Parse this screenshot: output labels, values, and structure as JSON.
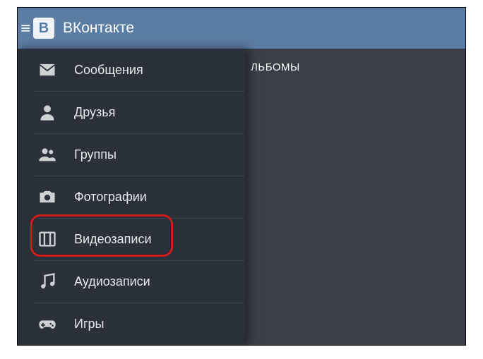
{
  "header": {
    "logo_letter": "В",
    "app_title": "ВКонтакте"
  },
  "content": {
    "visible_tab_fragment": "ЛЬБОМЫ"
  },
  "sidebar": {
    "items": [
      {
        "icon": "envelope-icon",
        "label": "Сообщения"
      },
      {
        "icon": "user-icon",
        "label": "Друзья"
      },
      {
        "icon": "group-icon",
        "label": "Группы"
      },
      {
        "icon": "camera-icon",
        "label": "Фотографии"
      },
      {
        "icon": "video-icon",
        "label": "Видеозаписи"
      },
      {
        "icon": "music-icon",
        "label": "Аудиозаписи"
      },
      {
        "icon": "gamepad-icon",
        "label": "Игры"
      }
    ]
  }
}
